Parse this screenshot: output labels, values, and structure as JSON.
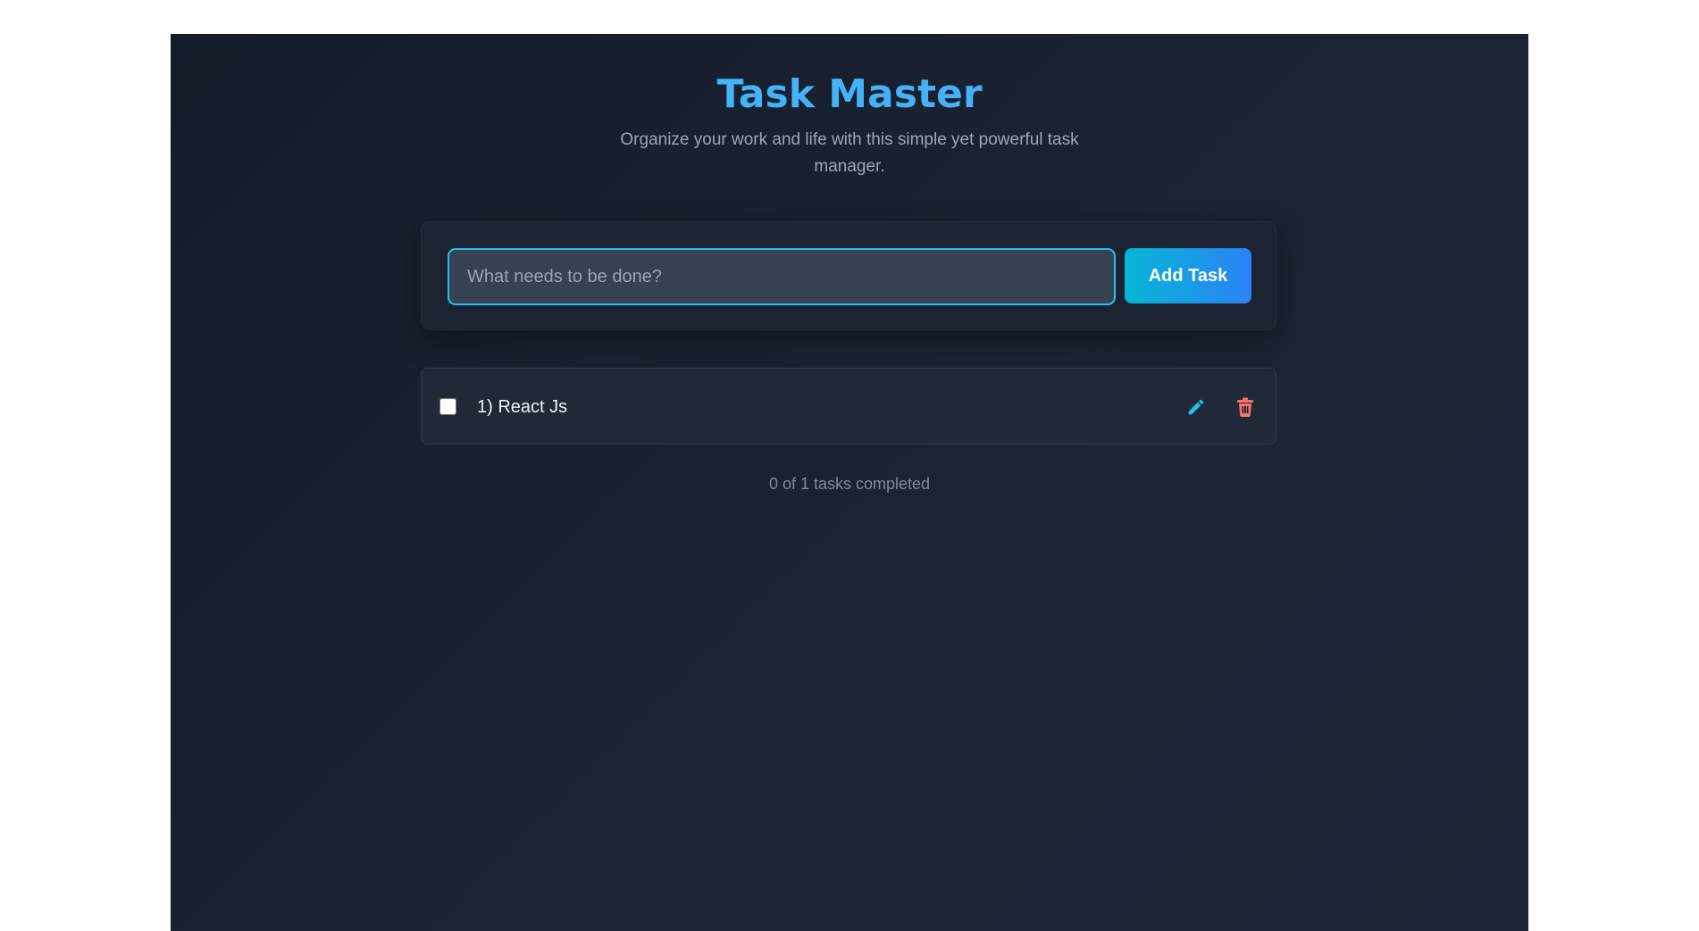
{
  "header": {
    "title": "Task Master",
    "subtitle": "Organize your work and life with this simple yet powerful task manager."
  },
  "new_task": {
    "placeholder": "What needs to be done?",
    "value": "",
    "add_label": "Add Task"
  },
  "tasks": [
    {
      "label": "1) React Js",
      "completed": false,
      "edit_icon": "pencil-icon",
      "delete_icon": "trash-icon"
    }
  ],
  "status": {
    "text": "0 of 1 tasks completed"
  },
  "colors": {
    "accent": "#22c3e6",
    "title": "#4ab3f4",
    "delete": "#f87171",
    "background": "#1a2232"
  }
}
